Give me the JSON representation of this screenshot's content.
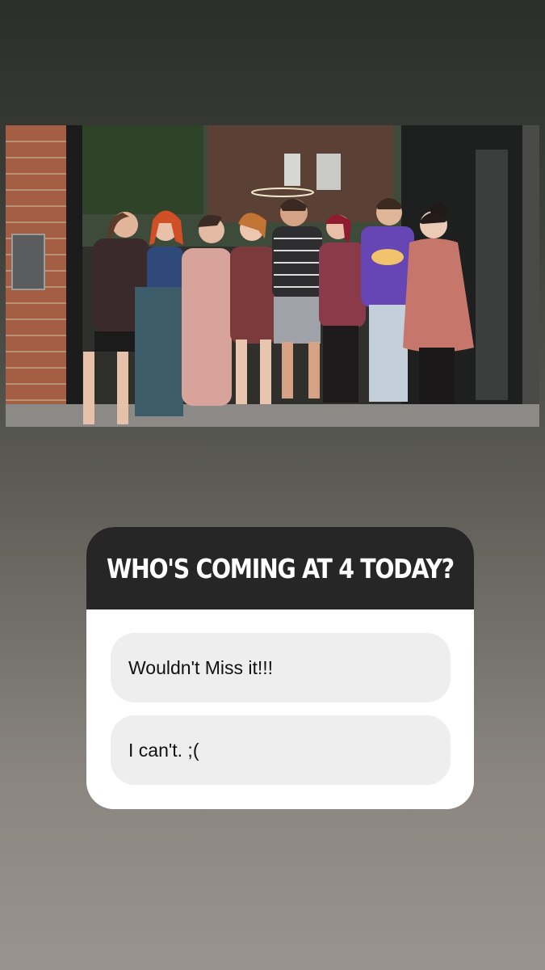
{
  "story": {
    "photo": {
      "description_icon": "group-photo-image"
    },
    "poll": {
      "question": "WHO'S COMING AT 4 TODAY?",
      "options": [
        {
          "label": "Wouldn't Miss it!!!"
        },
        {
          "label": "I can't. ;("
        }
      ]
    }
  }
}
